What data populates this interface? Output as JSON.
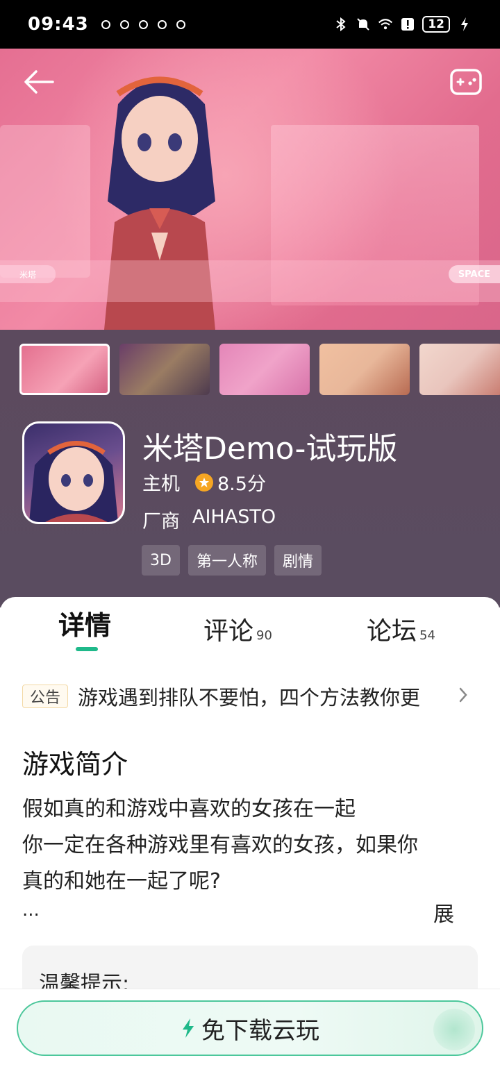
{
  "status_bar": {
    "time": "09:43",
    "battery": "12"
  },
  "hero": {
    "speaker_label": "米塔",
    "space_label": "SPACE"
  },
  "game": {
    "title": "米塔Demo-试玩版",
    "platform": "主机",
    "rating": "8.5分",
    "vendor_label": "厂商",
    "vendor_name": "AIHASTO",
    "tags": [
      "3D",
      "第一人称",
      "剧情"
    ]
  },
  "tabs": {
    "details": "详情",
    "reviews": "评论",
    "reviews_count": "90",
    "forum": "论坛",
    "forum_count": "54"
  },
  "notice": {
    "badge": "公告",
    "text": "游戏遇到排队不要怕，四个方法教你更"
  },
  "intro": {
    "title": "游戏简介",
    "lines": [
      "假如真的和游戏中喜欢的女孩在一起",
      "你一定在各种游戏里有喜欢的女孩，如果你",
      "真的和她在一起了呢?"
    ],
    "ellipsis": "...",
    "expand": "展"
  },
  "tip": {
    "title": "温馨提示:"
  },
  "cta": {
    "label": "免下载云玩"
  },
  "colors": {
    "accent": "#1fb98a",
    "panel_bg": "#5c4a5e",
    "star": "#f6a623"
  }
}
